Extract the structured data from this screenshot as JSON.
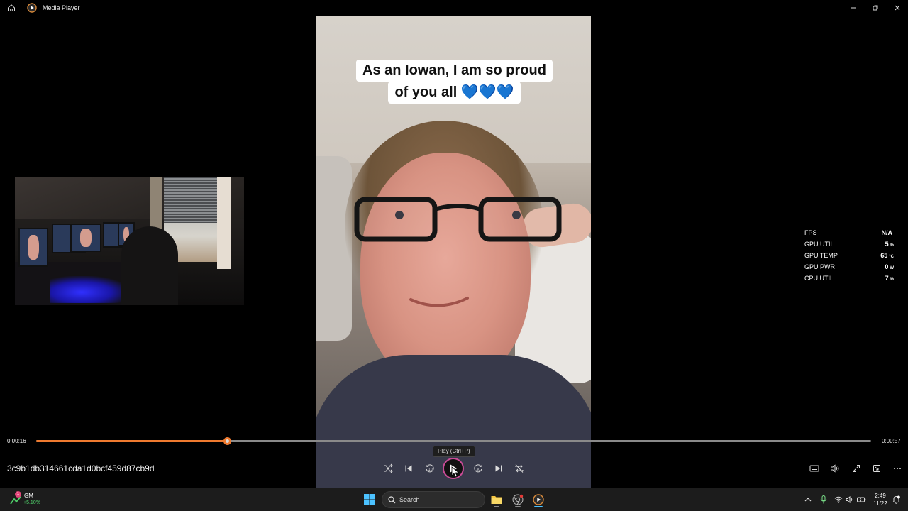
{
  "window": {
    "title": "Media Player"
  },
  "video": {
    "caption_line1": "As an Iowan, I am so proud",
    "caption_line2": "of you all 💙💙💙"
  },
  "stats": [
    {
      "label": "FPS",
      "value": "N/A",
      "unit": ""
    },
    {
      "label": "GPU UTIL",
      "value": "5",
      "unit": "%"
    },
    {
      "label": "GPU TEMP",
      "value": "65",
      "unit": "°C"
    },
    {
      "label": "GPU PWR",
      "value": "0",
      "unit": "W"
    },
    {
      "label": "CPU UTIL",
      "value": "7",
      "unit": "%"
    }
  ],
  "playback": {
    "current_time": "0:00:16",
    "total_time": "0:00:57",
    "progress": 0.2287,
    "filename": "3c9b1db314661cda1d0bcf459d87cb9d",
    "play_tooltip": "Play (Ctrl+P)"
  },
  "taskbar": {
    "widget_title": "GM",
    "widget_change": "+5.10%",
    "widget_badge": "1",
    "search_label": "Search",
    "clock_time": "2:49",
    "clock_date": "11/22"
  },
  "colors": {
    "accent": "#ef7a2f",
    "play_ring": "#c94b96"
  }
}
